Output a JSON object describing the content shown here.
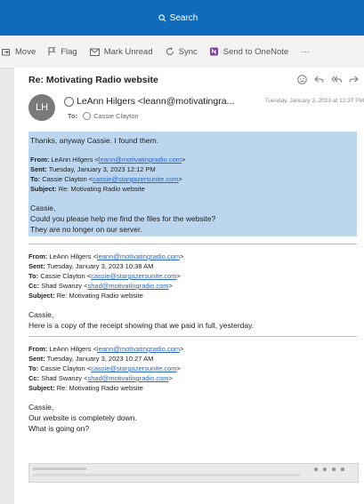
{
  "search": {
    "label": "Search"
  },
  "toolbar": {
    "move": "Move",
    "flag": "Flag",
    "mark_unread": "Mark Unread",
    "sync": "Sync",
    "onenote": "Send to OneNote",
    "more": "···",
    "onenote_color": "#7b3f9e"
  },
  "message": {
    "subject": "Re: Motivating Radio website",
    "avatar_initials": "LH",
    "from": "LeAnn Hilgers <leann@motivatingra...",
    "date": "Tuesday, January 3, 2023 at 12:37 PM",
    "to_label": "To:",
    "to": "Cassie Clayton",
    "selected": {
      "line1": "Thanks, anyway Cassie. I found them.",
      "hdr": {
        "from_label": "From:",
        "from_name": "LeAnn Hilgers <",
        "from_email": "leann@motivatingradio.com",
        "from_end": ">",
        "sent_label": "Sent:",
        "sent": "Tuesday, January 3, 2023 12:12 PM",
        "to_label": "To:",
        "to_name": "Cassie Clayton <",
        "to_email": "cassie@stargazersunite.com",
        "to_end": ">",
        "subject_label": "Subject:",
        "subject": "Re: Motivating Radio website"
      },
      "greeting": "Cassie,",
      "line2": "Could you please help me find the files for the website?",
      "line3": "They are no longer on our server."
    },
    "reply2": {
      "hdr": {
        "from_label": "From:",
        "from_name": "LeAnn Hilgers <",
        "from_email": "leann@motivatingradio.com",
        "from_end": ">",
        "sent_label": "Sent:",
        "sent": "Tuesday, January 3, 2023 10:38 AM",
        "to_label": "To:",
        "to_name": "Cassie Clayton <",
        "to_email": "cassie@stargazersunite.com",
        "to_end": ">",
        "cc_label": "Cc:",
        "cc_name": "Shad Swanzy <",
        "cc_email": "shad@motivatingradio.com",
        "cc_end": ">",
        "subject_label": "Subject:",
        "subject": "Re: Motivating Radio website"
      },
      "greeting": "Cassie,",
      "line1": "Here is a copy of the receipt showing that we paid in full, yesterday."
    },
    "reply3": {
      "hdr": {
        "from_label": "From:",
        "from_name": "LeAnn Hilgers <",
        "from_email": "leann@motivatingradio.com",
        "from_end": ">",
        "sent_label": "Sent:",
        "sent": "Tuesday, January 3, 2023 10:27 AM",
        "to_label": "To:",
        "to_name": "Cassie Clayton <",
        "to_email": "cassie@stargazersunite.com",
        "to_end": ">",
        "cc_label": "Cc:",
        "cc_name": "Shad Swanzy <",
        "cc_email": "shad@motivatingradio.com",
        "cc_end": ">",
        "subject_label": "Subject:",
        "subject": "Re: Motivating Radio website"
      },
      "greeting": "Cassie,",
      "line1": "Our website is completely down.",
      "line2": "What is going on?"
    }
  }
}
